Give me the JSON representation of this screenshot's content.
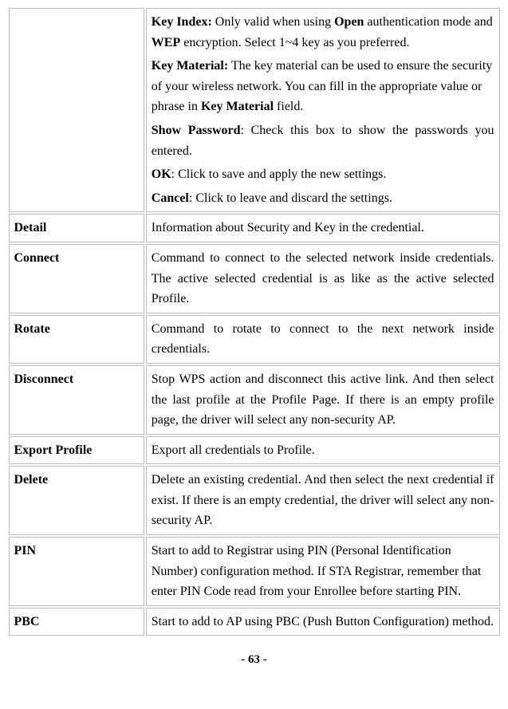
{
  "row1": {
    "keyIndexLabel": "Key Index:",
    "keyIndexText1": " Only valid when using ",
    "keyIndexOpen": "Open",
    "keyIndexText2": " authentication mode and ",
    "keyIndexWep": "WEP",
    "keyIndexText3": " encryption. Select 1~4 key as you preferred.",
    "keyMaterialLabel": "Key Material:",
    "keyMaterialText1": " The key material can be used to ensure the security of your wireless network. You can fill in the appropriate value or phrase in ",
    "keyMaterialBold": "Key Material",
    "keyMaterialText2": " field.",
    "showPasswordLabel": "Show Password",
    "showPasswordText": ": Check this box to show the passwords you entered.",
    "okLabel": "OK",
    "okText": ": Click to save and apply the new settings.",
    "cancelLabel": "Cancel",
    "cancelText": ": Click to leave and discard the settings."
  },
  "rows": {
    "detail": {
      "label": "Detail",
      "desc": "Information about Security and Key in the credential."
    },
    "connect": {
      "label": "Connect",
      "desc": "Command to connect to the selected network inside credentials. The active selected credential is as like as the active selected Profile."
    },
    "rotate": {
      "label": "Rotate",
      "desc": "Command to rotate to connect to the next network inside credentials."
    },
    "disconnect": {
      "label": "Disconnect",
      "desc": "Stop WPS action and disconnect this active link. And then select the last profile at the Profile Page. If there is an empty profile page, the driver will select any non-security AP."
    },
    "exportProfile": {
      "label": "Export Profile",
      "desc": "Export all credentials to Profile."
    },
    "delete": {
      "label": "Delete",
      "desc": "Delete an existing credential. And then select the next credential if exist. If there is an empty credential, the driver will select any non-security AP."
    },
    "pin": {
      "label": "PIN",
      "desc": "Start to add to Registrar using PIN (Personal Identification Number) configuration method. If STA Registrar, remember that enter PIN Code read from your Enrollee before starting PIN."
    },
    "pbc": {
      "label": "PBC",
      "desc": "Start to add to AP using PBC (Push Button Configuration) method."
    }
  },
  "pageNumber": "- 63 -"
}
